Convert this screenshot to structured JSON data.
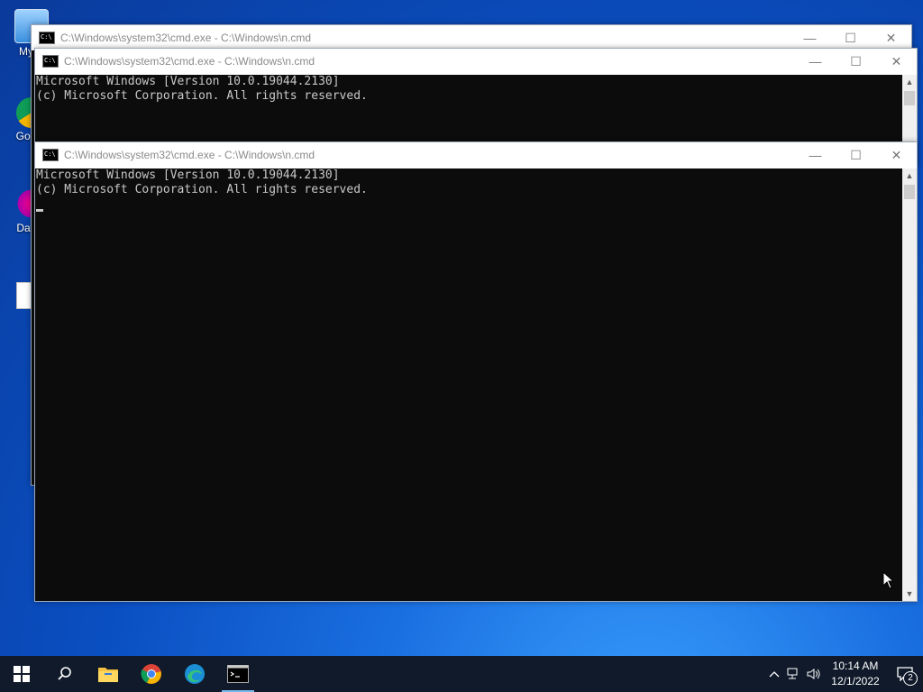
{
  "desktop_icons": [
    {
      "label": "My C",
      "icon": "this-pc-icon"
    },
    {
      "label": "Go Ch",
      "icon": "google-chrome-shortcut-icon"
    },
    {
      "label": "DataV",
      "icon": "datav-shortcut-icon"
    }
  ],
  "windows": [
    {
      "title": "C:\\Windows\\system32\\cmd.exe - C:\\Windows\\n.cmd",
      "lines": []
    },
    {
      "title": "C:\\Windows\\system32\\cmd.exe - C:\\Windows\\n.cmd",
      "lines": [
        "Microsoft Windows [Version 10.0.19044.2130]",
        "(c) Microsoft Corporation. All rights reserved."
      ]
    },
    {
      "title": "C:\\Windows\\system32\\cmd.exe - C:\\Windows\\n.cmd",
      "lines": [
        "Microsoft Windows [Version 10.0.19044.2130]",
        "(c) Microsoft Corporation. All rights reserved."
      ]
    }
  ],
  "window_buttons": {
    "minimize": "—",
    "maximize": "☐",
    "close": "✕"
  },
  "taskbar": {
    "items": [
      "start-button",
      "search-icon",
      "file-explorer-icon",
      "chrome-icon",
      "edge-icon",
      "command-prompt-icon"
    ],
    "active": "command-prompt-icon"
  },
  "tray": {
    "time": "10:14 AM",
    "date": "12/1/2022",
    "notification_count": "2"
  },
  "colors": {
    "console_bg": "#0c0c0c",
    "console_fg": "#c8c8c8",
    "taskbar_bg": "#101a2a",
    "accent": "#76b9ed"
  }
}
